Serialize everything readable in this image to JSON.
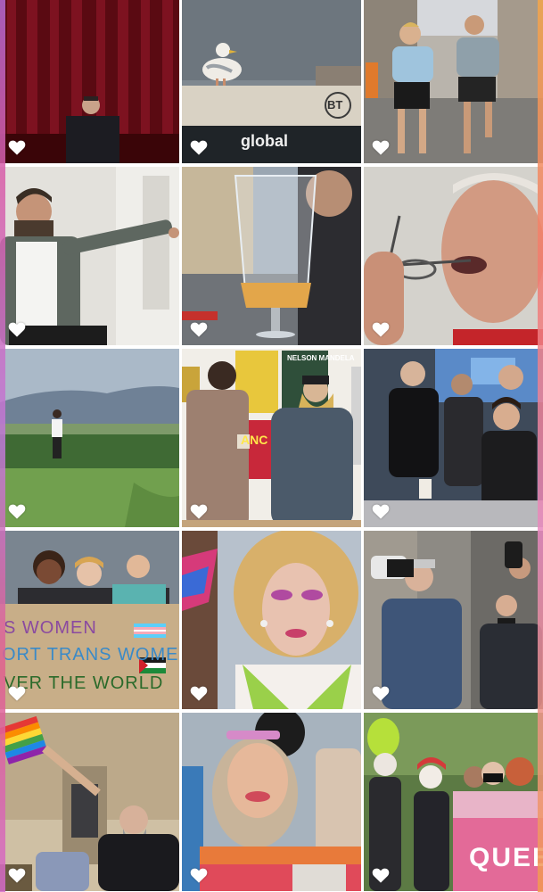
{
  "photos": [
    {
      "id": "speaker-red-curtain"
    },
    {
      "id": "seagull-sign"
    },
    {
      "id": "runners-street"
    },
    {
      "id": "man-pointing"
    },
    {
      "id": "beer-glass"
    },
    {
      "id": "man-glasses-mouth"
    },
    {
      "id": "woman-golf"
    },
    {
      "id": "gallery-conversation"
    },
    {
      "id": "event-crowd-boy"
    },
    {
      "id": "protest-sign-crowd"
    },
    {
      "id": "drag-queen"
    },
    {
      "id": "photographers"
    },
    {
      "id": "man-rainbow-flag"
    },
    {
      "id": "smiling-woman-flag"
    },
    {
      "id": "queer-banner-group"
    }
  ],
  "sign_text": {
    "bt_logo": "BT",
    "global_logo": "global",
    "protest_line1": "S WOMEN",
    "protest_line2": "ORT TRANS WOMEN",
    "protest_line3": "VER THE WORLD",
    "poster_anc": "ANC",
    "poster_mandela": "NELSON MANDELA",
    "banner_queer": "QUEE"
  },
  "favorite_icon": "heart-outline-icon",
  "colors": {
    "heart": "#ffffff",
    "background": "#ffffff"
  }
}
